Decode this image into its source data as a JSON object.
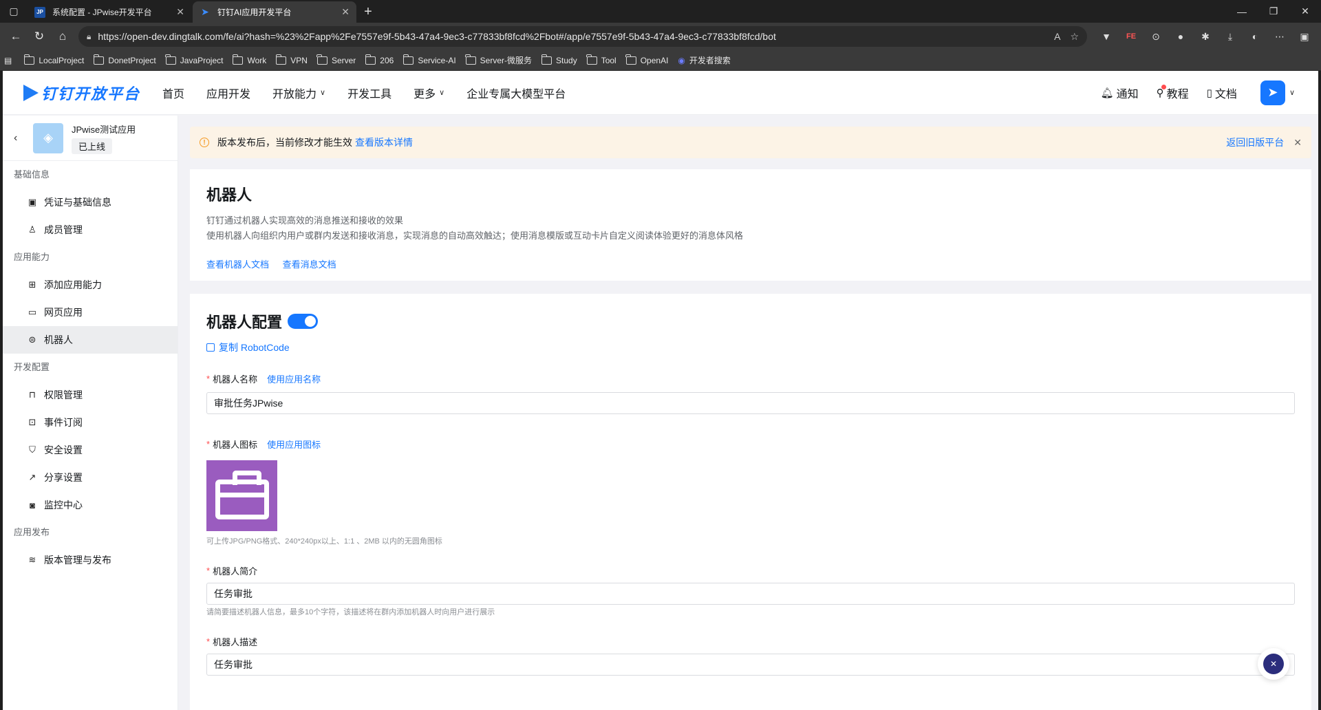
{
  "browser": {
    "tabs": [
      {
        "title": "系统配置 - JPwise开发平台",
        "favicon_text": "JP",
        "active": false
      },
      {
        "title": "钉钉AI应用开发平台",
        "favicon_text": "",
        "active": true
      }
    ],
    "url": "https://open-dev.dingtalk.com/fe/ai?hash=%23%2Fapp%2Fe7557e9f-5b43-47a4-9ec3-c77833bf8fcd%2Fbot#/app/e7557e9f-5b43-47a4-9ec3-c77833bf8fcd/bot",
    "bookmarks": [
      "LocalProject",
      "DonetProject",
      "JavaProject",
      "Work",
      "VPN",
      "Server",
      "206",
      "Service-AI",
      "Server-微服务",
      "Study",
      "Tool",
      "OpenAI",
      "开发者搜索"
    ]
  },
  "topnav": {
    "logo": "钉钉开放平台",
    "items": [
      "首页",
      "应用开发",
      "开放能力",
      "开发工具",
      "更多",
      "企业专属大模型平台"
    ],
    "notify": "通知",
    "tutorial": "教程",
    "docs": "文档"
  },
  "sidebar": {
    "app_name": "JPwise测试应用",
    "app_status": "已上线",
    "groups": [
      {
        "title": "基础信息",
        "items": [
          "凭证与基础信息",
          "成员管理"
        ]
      },
      {
        "title": "应用能力",
        "items": [
          "添加应用能力",
          "网页应用",
          "机器人"
        ]
      },
      {
        "title": "开发配置",
        "items": [
          "权限管理",
          "事件订阅",
          "安全设置",
          "分享设置",
          "监控中心"
        ]
      },
      {
        "title": "应用发布",
        "items": [
          "版本管理与发布"
        ]
      }
    ],
    "active_item": "机器人"
  },
  "notice": {
    "text": "版本发布后，当前修改才能生效",
    "link": "查看版本详情",
    "right_link": "返回旧版平台"
  },
  "robot_card": {
    "title": "机器人",
    "desc1": "钉钉通过机器人实现高效的消息推送和接收的效果",
    "desc2": "使用机器人向组织内用户或群内发送和接收消息，实现消息的自动高效触达；使用消息模版或互动卡片自定义阅读体验更好的消息体风格",
    "link1": "查看机器人文档",
    "link2": "查看消息文档"
  },
  "config_card": {
    "title": "机器人配置",
    "toggle_on": true,
    "copy_label": "复制 RobotCode",
    "name_label": "机器人名称",
    "name_use": "使用应用名称",
    "name_value": "审批任务JPwise",
    "icon_label": "机器人图标",
    "icon_use": "使用应用图标",
    "icon_hint": "可上传JPG/PNG格式、240*240px以上、1:1 、2MB 以内的无圆角图标",
    "brief_label": "机器人简介",
    "brief_value": "任务审批",
    "brief_hint": "请简要描述机器人信息，最多10个字符，该描述将在群内添加机器人时向用户进行展示",
    "desc_label": "机器人描述",
    "desc_value": "任务审批"
  },
  "colors": {
    "primary": "#1677ff",
    "notice_bg": "#fcf3e6",
    "robot_icon_bg": "#9a5cbf"
  }
}
